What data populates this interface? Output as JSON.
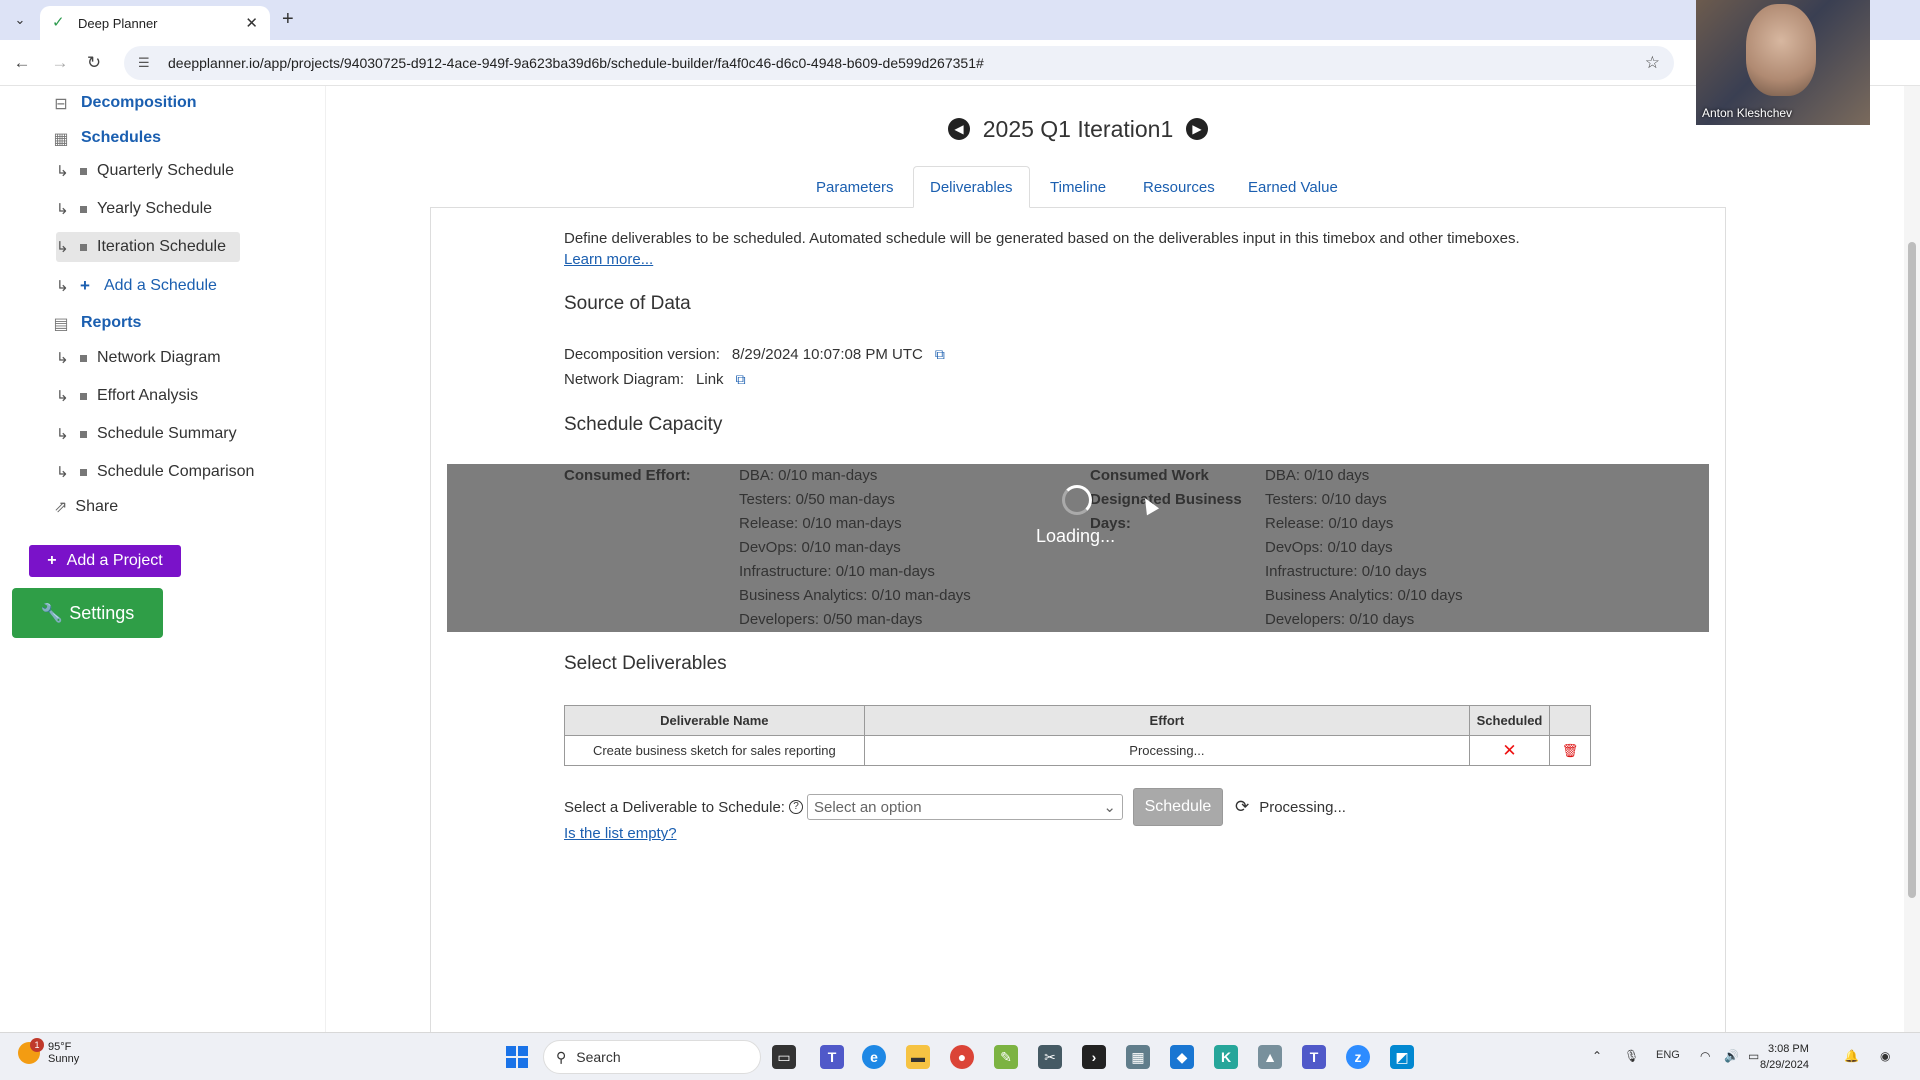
{
  "browser": {
    "tab_title": "Deep Planner",
    "url": "deepplanner.io/app/projects/94030725-d912-4ace-949f-9a623ba39d6b/schedule-builder/fa4f0c46-d6c0-4948-b609-de599d267351#"
  },
  "webcam": {
    "name": "Anton Kleshchev"
  },
  "sidebar": {
    "decomposition": "Decomposition",
    "schedules": "Schedules",
    "schedule_items": [
      "Quarterly Schedule",
      "Yearly Schedule",
      "Iteration Schedule"
    ],
    "add_schedule": "Add a Schedule",
    "reports": "Reports",
    "report_items": [
      "Network Diagram",
      "Effort Analysis",
      "Schedule Summary",
      "Schedule Comparison"
    ],
    "share": "Share",
    "add_project": "Add a Project",
    "settings": "Settings"
  },
  "page": {
    "iteration_title": "2025 Q1 Iteration1",
    "tabs": [
      "Parameters",
      "Deliverables",
      "Timeline",
      "Resources",
      "Earned Value"
    ],
    "active_tab": "Deliverables",
    "description": "Define deliverables to be scheduled. Automated schedule will be generated based on the deliverables input in this timebox and other timeboxes.",
    "learn_more": "Learn more...",
    "source_heading": "Source of Data",
    "decomposition_version_label": "Decomposition version:",
    "decomposition_version_value": "8/29/2024 10:07:08 PM UTC",
    "network_diagram_label": "Network Diagram:",
    "network_diagram_value": "Link",
    "capacity_heading": "Schedule Capacity",
    "consumed_effort_label": "Consumed Effort:",
    "consumed_effort": [
      "DBA: 0/10 man-days",
      "Testers: 0/50 man-days",
      "Release: 0/10 man-days",
      "DevOps: 0/10 man-days",
      "Infrastructure: 0/10 man-days",
      "Business Analytics: 0/10 man-days",
      "Developers: 0/50 man-days"
    ],
    "consumed_work_label": [
      "Consumed Work",
      "Designated Business",
      "Days:"
    ],
    "consumed_work": [
      "DBA: 0/10 days",
      "Testers: 0/10 days",
      "Release: 0/10 days",
      "DevOps: 0/10 days",
      "Infrastructure: 0/10 days",
      "Business Analytics: 0/10 days",
      "Developers: 0/10 days"
    ],
    "loading_text": "Loading...",
    "select_heading": "Select Deliverables",
    "table": {
      "headers": [
        "Deliverable Name",
        "Effort",
        "Scheduled"
      ],
      "rows": [
        {
          "name": "Create business sketch for sales reporting",
          "effort": "Processing..."
        }
      ]
    },
    "select_label": "Select a Deliverable to Schedule:",
    "select_placeholder": "Select an option",
    "schedule_button": "Schedule",
    "processing": "Processing...",
    "list_empty": "Is the list empty?"
  },
  "taskbar": {
    "weather_temp": "95°F",
    "weather_cond": "Sunny",
    "weather_badge": "1",
    "search": "Search",
    "lang": "ENG",
    "time": "3:08 PM",
    "date": "8/29/2024"
  }
}
